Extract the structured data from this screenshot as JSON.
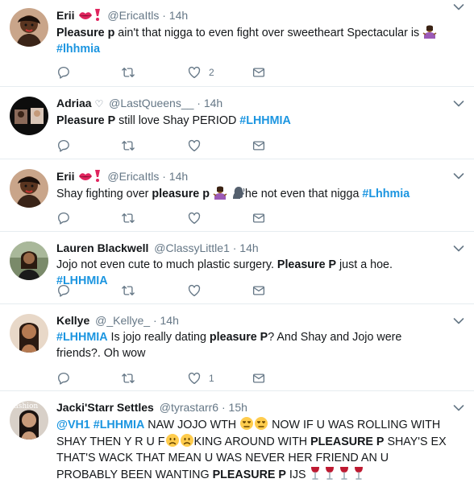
{
  "tweets": [
    {
      "name": "Erii",
      "handle": "@EricaItls",
      "time": "· 14h",
      "text_parts": [
        "Pleasure p",
        " ain't that nigga to even fight over sweetheart Spectacular is"
      ],
      "hashtag": "#lhhmia",
      "reply_count": "",
      "retweet_count": "",
      "like_count": "2"
    },
    {
      "name": "Adriaa",
      "handle": "@LastQueens__",
      "time": "· 14h",
      "text_parts": [
        "Pleasure P",
        " still love Shay PERIOD "
      ],
      "hashtag": "#LHHMIA",
      "like_count": ""
    },
    {
      "name": "Erii",
      "handle": "@EricaItls",
      "time": "· 14h",
      "text_parts": [
        "Shay fighting over ",
        "pleasure p",
        "he not even that nigga "
      ],
      "hashtag": "#Lhhmia",
      "like_count": ""
    },
    {
      "name": "Lauren Blackwell",
      "handle": "@ClassyLittle1",
      "time": "· 14h",
      "text_parts": [
        "Jojo not even cute to much plastic surgery. ",
        "Pleasure P",
        " just a hoe. "
      ],
      "hashtag": "#LHHMIA",
      "like_count": ""
    },
    {
      "name": "Kellye",
      "handle": "@_Kellye_",
      "time": "· 14h",
      "hashtag": "#LHHMIA",
      "text_parts": [
        " Is jojo really dating ",
        "pleasure P",
        "? And Shay and Jojo were friends?. Oh wow"
      ],
      "like_count": "1"
    },
    {
      "name": "Jacki'Starr Settles",
      "handle": "@tyrastarr6",
      "time": "· 15h",
      "mention": "@VH1",
      "hashtag": "#LHHMIA",
      "text_parts": [
        " NAW JOJO WTH ",
        " NOW IF U WAS ROLLING WITH SHAY THEN Y R U F",
        "KING AROUND WITH ",
        "PLEASURE P",
        " SHAY'S EX THAT'S WACK THAT MEAN U WAS NEVER HER FRIEND AN U PROBABLY BEEN WANTING ",
        "PLEASURE P",
        " IJS "
      ],
      "avatar_label": "fashion"
    }
  ],
  "colors": {
    "link": "#1b95e0",
    "muted": "#657786",
    "divider": "#e6ecf0"
  },
  "icons": [
    "reply-icon",
    "retweet-icon",
    "like-icon",
    "dm-icon",
    "chevron-down-icon",
    "kiss-icon",
    "exclamation-icon",
    "shrug-icon",
    "speaking-head-icon",
    "unamused-icon",
    "frown-icon",
    "wine-glass-icon"
  ]
}
